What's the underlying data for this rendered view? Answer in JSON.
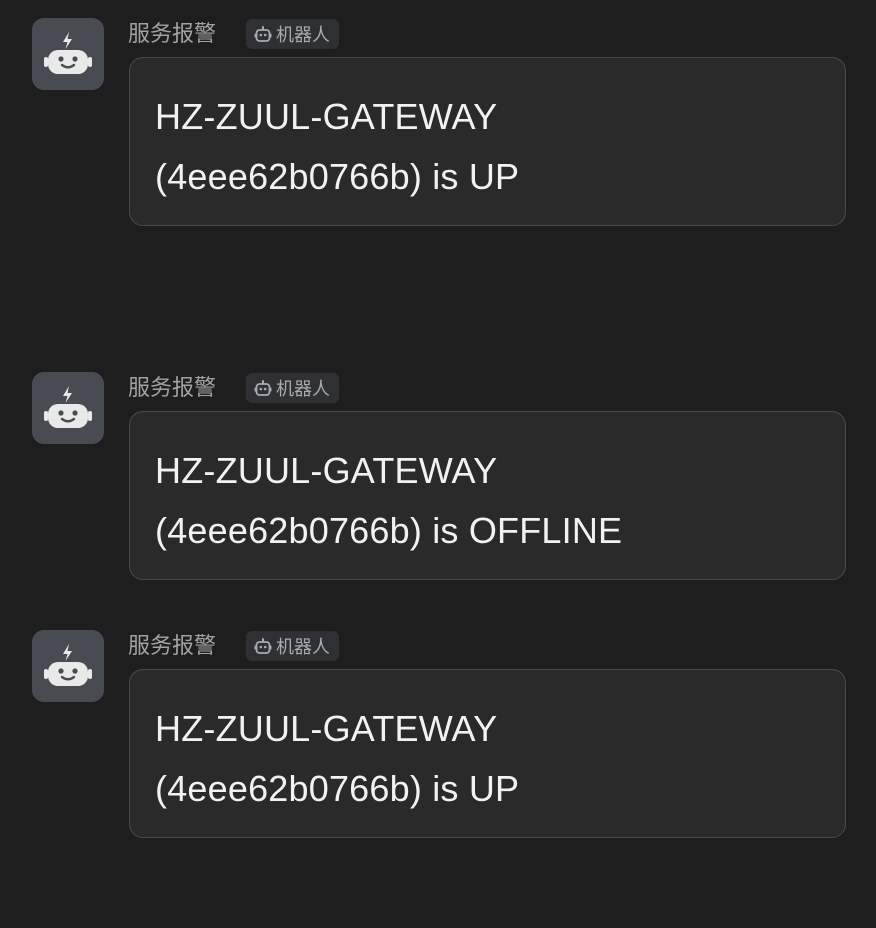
{
  "messages": [
    {
      "sender": "服务报警",
      "tag_label": "机器人",
      "line1": "HZ-ZUUL-GATEWAY",
      "line2": "(4eee62b0766b) is UP"
    },
    {
      "sender": "服务报警",
      "tag_label": "机器人",
      "line1": "HZ-ZUUL-GATEWAY",
      "line2": "(4eee62b0766b) is OFFLINE"
    },
    {
      "sender": "服务报警",
      "tag_label": "机器人",
      "line1": "HZ-ZUUL-GATEWAY",
      "line2": "(4eee62b0766b) is UP"
    }
  ],
  "icons": {
    "avatar": "robot-icon",
    "tag": "robot-icon"
  },
  "colors": {
    "background": "#1e1e1e",
    "bubble": "#2a2a2a",
    "bubble_border": "#4a4a4c",
    "avatar_bg": "#484b51",
    "text": "#f2f2f2",
    "sender": "#a2a2a2"
  }
}
